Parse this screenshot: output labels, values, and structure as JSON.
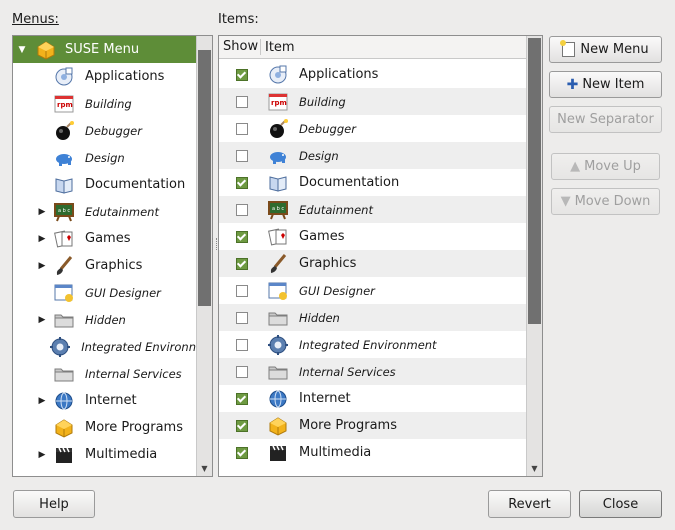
{
  "menus_label": "Menus:",
  "items_label": "Items:",
  "menus_tree": [
    {
      "label": "SUSE Menu",
      "icon": "suse-menu-icon",
      "italic": false,
      "expander": "open",
      "selected": true
    },
    {
      "label": "Applications",
      "icon": "applications-icon",
      "italic": false,
      "expander": ""
    },
    {
      "label": "Building",
      "icon": "rpm-building-icon",
      "italic": true,
      "expander": ""
    },
    {
      "label": "Debugger",
      "icon": "bomb-debugger-icon",
      "italic": true,
      "expander": ""
    },
    {
      "label": "Design",
      "icon": "elephant-design-icon",
      "italic": true,
      "expander": ""
    },
    {
      "label": "Documentation",
      "icon": "book-documentation-icon",
      "italic": false,
      "expander": ""
    },
    {
      "label": "Edutainment",
      "icon": "chalkboard-edutainment-icon",
      "italic": true,
      "expander": "closed"
    },
    {
      "label": "Games",
      "icon": "cards-games-icon",
      "italic": false,
      "expander": "closed"
    },
    {
      "label": "Graphics",
      "icon": "brush-graphics-icon",
      "italic": false,
      "expander": "closed"
    },
    {
      "label": "GUI Designer",
      "icon": "gui-designer-icon",
      "italic": true,
      "expander": ""
    },
    {
      "label": "Hidden",
      "icon": "folder-hidden-icon",
      "italic": true,
      "expander": "closed"
    },
    {
      "label": "Integrated Environn",
      "icon": "gear-ide-icon",
      "italic": true,
      "expander": ""
    },
    {
      "label": "Internal Services",
      "icon": "folder-services-icon",
      "italic": true,
      "expander": ""
    },
    {
      "label": "Internet",
      "icon": "globe-internet-icon",
      "italic": false,
      "expander": "closed"
    },
    {
      "label": "More Programs",
      "icon": "suse-more-icon",
      "italic": false,
      "expander": ""
    },
    {
      "label": "Multimedia",
      "icon": "clapper-multimedia-icon",
      "italic": false,
      "expander": "closed"
    }
  ],
  "items_table": {
    "col_show": "Show",
    "col_item": "Item",
    "rows": [
      {
        "label": "Applications",
        "icon": "applications-icon",
        "italic": false,
        "show": true
      },
      {
        "label": "Building",
        "icon": "rpm-building-icon",
        "italic": true,
        "show": false
      },
      {
        "label": "Debugger",
        "icon": "bomb-debugger-icon",
        "italic": true,
        "show": false
      },
      {
        "label": "Design",
        "icon": "elephant-design-icon",
        "italic": true,
        "show": false
      },
      {
        "label": "Documentation",
        "icon": "book-documentation-icon",
        "italic": false,
        "show": true
      },
      {
        "label": "Edutainment",
        "icon": "chalkboard-edutainment-icon",
        "italic": true,
        "show": false
      },
      {
        "label": "Games",
        "icon": "cards-games-icon",
        "italic": false,
        "show": true
      },
      {
        "label": "Graphics",
        "icon": "brush-graphics-icon",
        "italic": false,
        "show": true
      },
      {
        "label": "GUI Designer",
        "icon": "gui-designer-icon",
        "italic": true,
        "show": false
      },
      {
        "label": "Hidden",
        "icon": "folder-hidden-icon",
        "italic": true,
        "show": false
      },
      {
        "label": "Integrated Environment",
        "icon": "gear-ide-icon",
        "italic": true,
        "show": false
      },
      {
        "label": "Internal Services",
        "icon": "folder-services-icon",
        "italic": true,
        "show": false
      },
      {
        "label": "Internet",
        "icon": "globe-internet-icon",
        "italic": false,
        "show": true
      },
      {
        "label": "More Programs",
        "icon": "suse-more-icon",
        "italic": false,
        "show": true
      },
      {
        "label": "Multimedia",
        "icon": "clapper-multimedia-icon",
        "italic": false,
        "show": true
      }
    ]
  },
  "buttons": {
    "new_menu": "New Menu",
    "new_item": "New Item",
    "new_separator": "New Separator",
    "move_up": "Move Up",
    "move_down": "Move Down",
    "help": "Help",
    "revert": "Revert",
    "close": "Close"
  },
  "colors": {
    "selection": "#5e8d38",
    "check": "#6e9a42"
  }
}
